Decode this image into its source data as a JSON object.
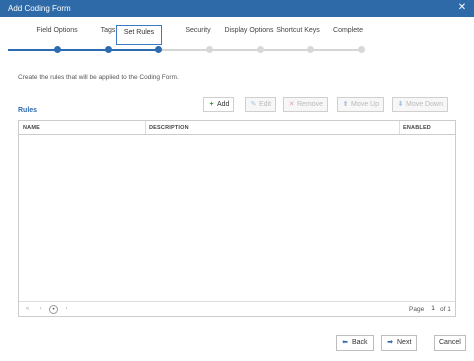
{
  "dialog": {
    "title": "Add Coding Form",
    "close_icon": "close-icon"
  },
  "wizard": {
    "steps": [
      {
        "label": "Field Options",
        "state": "done"
      },
      {
        "label": "Tags",
        "state": "done"
      },
      {
        "label": "Set Rules",
        "state": "active"
      },
      {
        "label": "Security",
        "state": "todo"
      },
      {
        "label": "Display Options",
        "state": "todo"
      },
      {
        "label": "Shortcut Keys",
        "state": "todo"
      },
      {
        "label": "Complete",
        "state": "todo"
      }
    ],
    "active_color": "#2d6bb0"
  },
  "instructions": "Create the rules that will be applied to the Coding Form.",
  "rules_section": {
    "title": "Rules",
    "toolbar": {
      "add_label": "Add",
      "edit_label": "Edit",
      "remove_label": "Remove",
      "move_up_label": "Move Up",
      "move_down_label": "Move Down"
    },
    "grid": {
      "columns": [
        "NAME",
        "DESCRIPTION",
        "ENABLED"
      ],
      "rows": [],
      "pager": {
        "page_label": "Page",
        "current_page": "1",
        "of_label": "of 1"
      }
    }
  },
  "footer": {
    "back_label": "Back",
    "next_label": "Next",
    "cancel_label": "Cancel"
  }
}
